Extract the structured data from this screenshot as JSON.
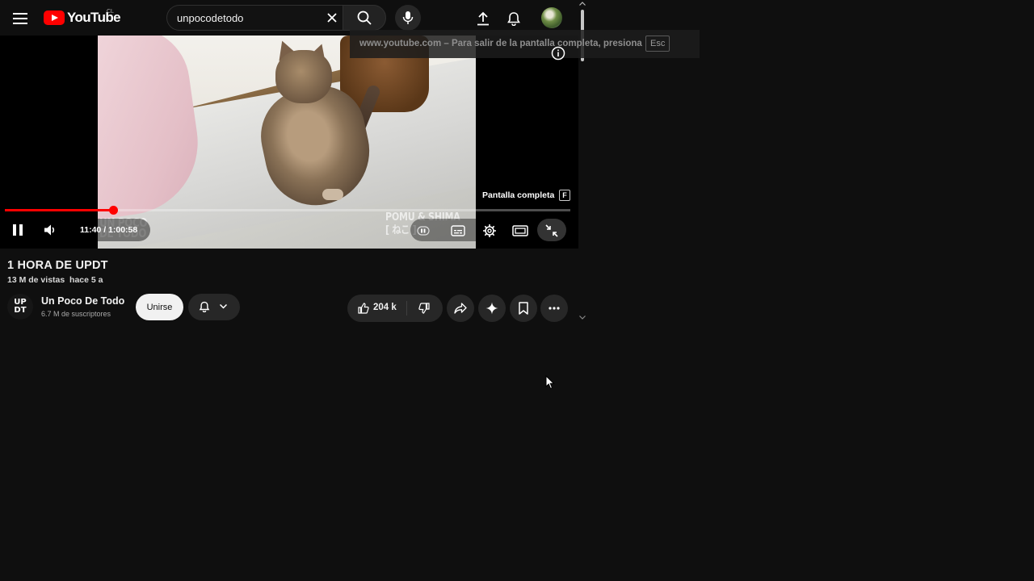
{
  "header": {
    "logo_text": "YouTube",
    "country_code": "CL",
    "search_value": "unpocodetodo"
  },
  "player": {
    "fullscreen_notice": "www.youtube.com – Para salir de la pantalla completa, presiona",
    "fullscreen_notice_key": "Esc",
    "tooltip_label": "Pantalla completa",
    "tooltip_key": "F",
    "current_time": "11:40",
    "duration": "1:00:58",
    "progress_fraction": 0.1914,
    "state": "playing",
    "watermark_left": "UN POCO\nDE TODO",
    "watermark_right": "POMU & SHIMA\n[ ねこ ]"
  },
  "video": {
    "title": "1 HORA DE UPDT",
    "views": "13 M de vistas",
    "age": "hace 5 a"
  },
  "channel": {
    "avatar_text": "UP\nDT",
    "name": "Un Poco De Todo",
    "subscribers": "6.7 M de suscriptores",
    "join_label": "Unirse"
  },
  "actions": {
    "like_count": "204 k"
  },
  "icons": {
    "menu": "menu-icon",
    "search": "search-icon",
    "clear": "close-icon",
    "mic": "mic-icon",
    "upload": "upload-icon",
    "notifications": "bell-icon",
    "pause": "pause-icon",
    "volume": "volume-icon",
    "miniplayer": "miniplayer-icon",
    "subtitles": "subtitles-icon",
    "settings": "gear-icon",
    "theater": "theater-icon",
    "fullscreen_exit": "fullscreen-exit-icon",
    "info": "info-icon",
    "like": "thumbs-up-icon",
    "dislike": "thumbs-down-icon",
    "share": "share-icon",
    "ask": "sparkle-icon",
    "save": "bookmark-icon",
    "more": "more-icon"
  },
  "colors": {
    "background": "#0f0f0f",
    "brand_red": "#ff0000",
    "chip_bg": "#272727"
  }
}
